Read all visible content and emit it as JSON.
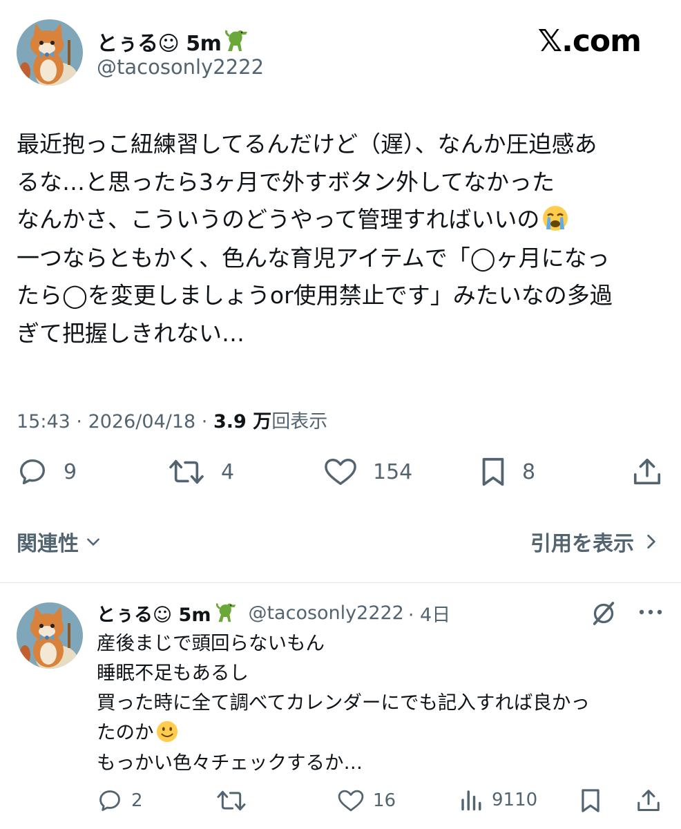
{
  "brand": {
    "site_label": "𝕏.com"
  },
  "main_tweet": {
    "author_name": "とぅる☺︎ 5m",
    "author_emoji": "dinosaur-emoji",
    "handle": "@tacosonly2222",
    "text_lines": [
      "最近抱っこ紐練習してるんだけど（遅）、なんか圧迫感あ",
      "るな…と思ったら3ヶ月で外すボタン外してなかった",
      "なんかさ、こういうのどうやって管理すればいいの",
      "一つならともかく、色んな育児アイテムで「◯ヶ月になっ",
      "たら◯を変更しましょうor使用禁止です」みたいなの多過",
      "ぎて把握しきれない…"
    ],
    "time": "15:43",
    "date": "2026/04/18",
    "views_count": "3.9 万",
    "views_label": "回表示",
    "replies": "9",
    "reposts": "4",
    "likes": "154",
    "bookmarks": "8",
    "sort_label": "関連性",
    "quotes_label": "引用を表示"
  },
  "reply": {
    "author_name": "とぅる☺︎ 5m",
    "handle": "@tacosonly2222",
    "time": "· 4日",
    "text_lines": [
      "産後まじで頭回らないもん",
      "睡眠不足もあるし",
      "買った時に全て調べてカレンダーにでも記入すれば良かっ",
      "たのか",
      "もっかい色々チェックするか…"
    ],
    "replies": "2",
    "reposts": "",
    "likes": "16",
    "views": "9110"
  },
  "colors": {
    "text_primary": "#0f1419",
    "text_secondary": "#536471",
    "divider": "#e6e9eb",
    "avatar_bg": "#7fa7b9",
    "cat_orange": "#d9823b"
  }
}
